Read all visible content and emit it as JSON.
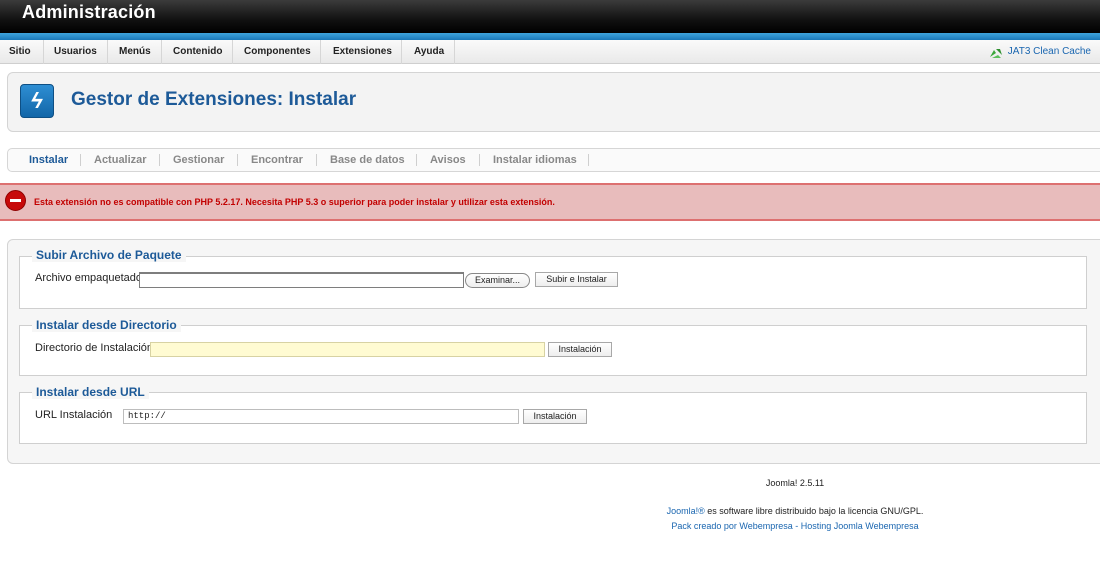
{
  "header": {
    "title": "Administración"
  },
  "menu": {
    "items": [
      {
        "label": "Sitio"
      },
      {
        "label": "Usuarios"
      },
      {
        "label": "Menús"
      },
      {
        "label": "Contenido"
      },
      {
        "label": "Componentes"
      },
      {
        "label": "Extensiones"
      },
      {
        "label": "Ayuda"
      }
    ],
    "cache_label": "JAT3 Clean Cache"
  },
  "page": {
    "title": "Gestor de Extensiones: Instalar"
  },
  "tabs": [
    {
      "label": "Instalar",
      "active": true
    },
    {
      "label": "Actualizar"
    },
    {
      "label": "Gestionar"
    },
    {
      "label": "Encontrar"
    },
    {
      "label": "Base de datos"
    },
    {
      "label": "Avisos"
    },
    {
      "label": "Instalar idiomas"
    }
  ],
  "error": {
    "message": "Esta extensión no es compatible con PHP 5.2.17. Necesita PHP 5.3 o superior para poder instalar y utilizar esta extensión."
  },
  "upload": {
    "legend": "Subir Archivo de Paquete",
    "label": "Archivo empaquetado",
    "browse_label": "Examinar...",
    "submit_label": "Subir e Instalar"
  },
  "directory": {
    "legend": "Instalar desde Directorio",
    "label": "Directorio de Instalación",
    "value": "",
    "button_label": "Instalación"
  },
  "url": {
    "legend": "Instalar desde URL",
    "label": "URL Instalación",
    "value": "http://",
    "button_label": "Instalación"
  },
  "footer": {
    "version": "Joomla! 2.5.11",
    "license_link": "Joomla!®",
    "license_text": " es software libre distribuido bajo la licencia GNU/GPL.",
    "credit_text": "Pack creado por Webempresa - Hosting Joomla Webempresa"
  },
  "colors": {
    "accent_blue": "#1d5a98",
    "error_red": "#c20000",
    "error_bg": "#e8bcbc"
  }
}
